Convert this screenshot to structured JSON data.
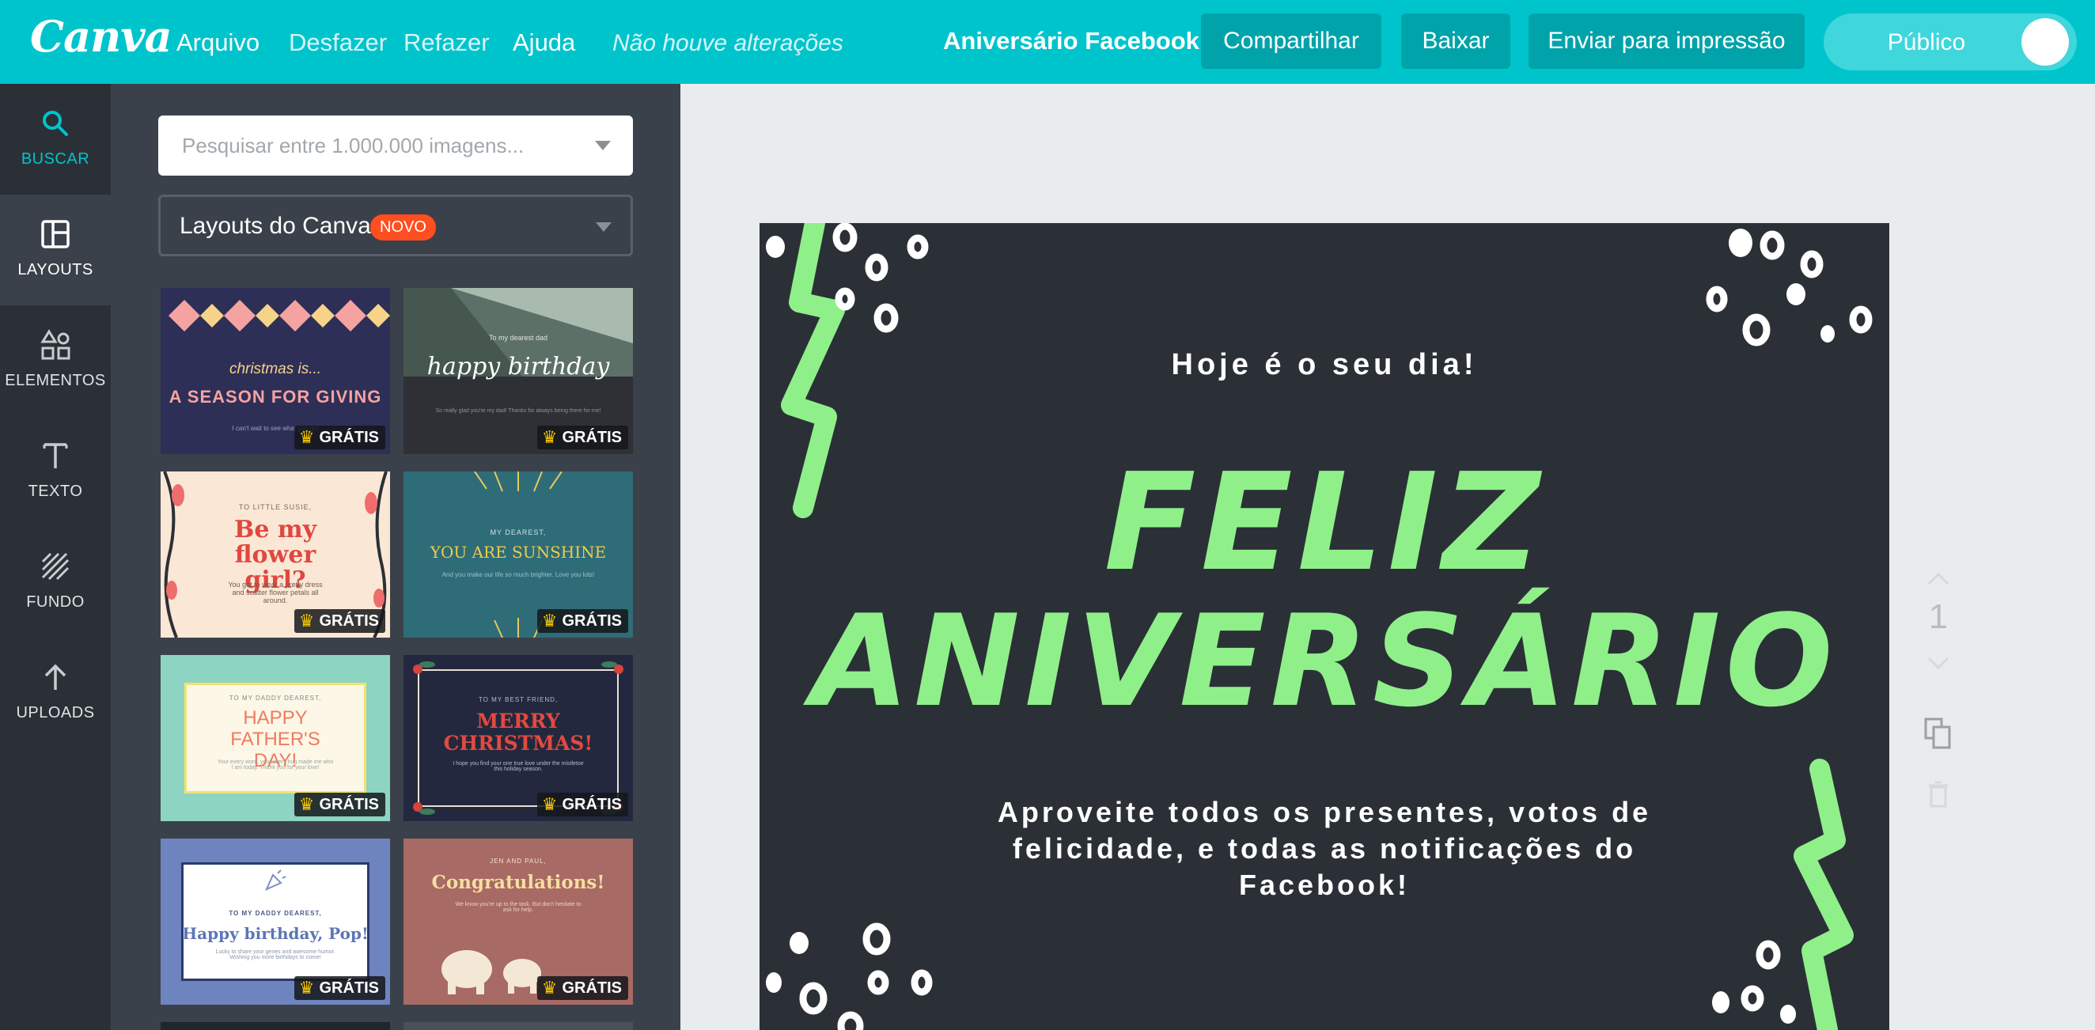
{
  "topbar": {
    "logo": "Canva",
    "menu": [
      "Arquivo",
      "Desfazer",
      "Refazer",
      "Ajuda"
    ],
    "save_status": "Não houve alterações",
    "doc_title": "Aniversário Facebook",
    "share_label": "Compartilhar",
    "download_label": "Baixar",
    "print_label": "Enviar para impressão",
    "visibility_label": "Público"
  },
  "rail": {
    "items": [
      {
        "label": "BUSCAR",
        "icon": "search-icon"
      },
      {
        "label": "LAYOUTS",
        "icon": "layout-icon"
      },
      {
        "label": "ELEMENTOS",
        "icon": "shapes-icon"
      },
      {
        "label": "TEXTO",
        "icon": "text-icon"
      },
      {
        "label": "FUNDO",
        "icon": "background-icon"
      },
      {
        "label": "UPLOADS",
        "icon": "upload-icon"
      }
    ]
  },
  "panel": {
    "search_placeholder": "Pesquisar entre 1.000.000 imagens...",
    "layouts_select": "Layouts do Canva",
    "new_badge": "NOVO",
    "free_label": "GRÁTIS",
    "thumbnails": [
      {
        "l1": "christmas is...",
        "l2": "A SEASON FOR GIVING",
        "l3": "I can't wait to see what you get"
      },
      {
        "l1": "To my dearest dad",
        "l2": "happy birthday",
        "l3": "So really glad you're my dad! Thanks for always being there for me!"
      },
      {
        "l1": "TO LITTLE SUSIE,",
        "l2": "Be my flower girl?",
        "l3": "You get to wear a pretty dress and scatter flower petals all around."
      },
      {
        "l1": "MY DEAREST,",
        "l2": "YOU ARE SUNSHINE",
        "l3": "And you make our life so much brighter. Love you lots!"
      },
      {
        "l1": "TO MY DADDY DEAREST,",
        "l2": "HAPPY FATHER'S DAY!",
        "l3": "Your every word, your every hug made me who I am today. Thank you for your love!"
      },
      {
        "l1": "TO MY BEST FRIEND,",
        "l2": "MERRY CHRISTMAS!",
        "l3": "I hope you find your one true love under the mistletoe this holiday season."
      },
      {
        "l1": "TO MY DADDY DEAREST,",
        "l2": "Happy birthday, Pop!",
        "l3": "Lucky to share your genes and awesome humor. Wishing you more birthdays to come!"
      },
      {
        "l1": "JEN AND PAUL,",
        "l2": "Congratulations!",
        "l3": "We know you're up to the task. But don't hesitate to ask for help."
      }
    ]
  },
  "design": {
    "subtitle": "Hoje é o seu dia!",
    "title_line1": "FELIZ",
    "title_line2": "ANIVERSÁRIO",
    "message": "Aproveite todos os presentes, votos de felicidade, e todas as notificações do Facebook!",
    "colors": {
      "background": "#2b3037",
      "accent": "#8ff08a",
      "text": "#ffffff"
    }
  },
  "page_controls": {
    "page_number": "1"
  }
}
